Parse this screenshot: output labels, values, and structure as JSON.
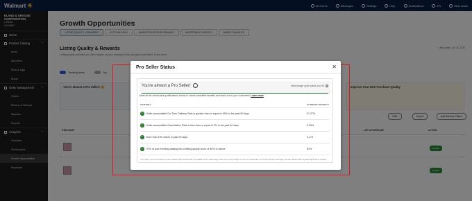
{
  "topbar": {
    "brand": "Walmart",
    "brand_sub": "Seller Center",
    "nav": [
      {
        "label": "All Stores",
        "icon": "store-icon"
      },
      {
        "label": "Messages",
        "icon": "message-icon"
      },
      {
        "label": "Settings",
        "icon": "gear-icon"
      },
      {
        "label": "Help",
        "icon": "help-icon"
      },
      {
        "label": "Notifications",
        "icon": "bell-icon"
      },
      {
        "label": "EN",
        "icon": "globe-icon"
      },
      {
        "label": "Hello Ansel",
        "icon": "user-icon"
      }
    ]
  },
  "sidebar": {
    "org_name": "ELAND & GROUSE CORPORATION",
    "org_line1": "LONDA",
    "org_line2": "10026867",
    "sections": [
      {
        "label": "Home",
        "icon": "home-icon",
        "items": []
      },
      {
        "label": "Product Catalog",
        "icon": "catalog-icon",
        "items": [
          "Items",
          "Add Items",
          "Price & Tags",
          "Brand"
        ]
      },
      {
        "label": "Order Management",
        "icon": "order-icon",
        "items": [
          "Orders",
          "Returns & Refunds",
          "Disputes",
          "Reports"
        ]
      },
      {
        "label": "Analytics",
        "icon": "analytics-icon",
        "items": [
          "Overview",
          "Performance",
          "Growth Opportunities",
          "Payments"
        ]
      }
    ],
    "active_item": "Growth Opportunities"
  },
  "main": {
    "title": "Growth Opportunities",
    "tabs": [
      "LISTING QUALITY & REWARDS",
      "OUTCOME VIEW",
      "MARKETPLACE PERFORMANCE",
      "ASSORTMENT GROWTH",
      "MARKET INSIGHTS"
    ],
    "subtitle": "Listing Quality & Rewards",
    "description": "Listing quality provides you with insights on your catalog to help you grow your sales. Learn more",
    "last_updated": "Last update: Jun 28, 2023",
    "toggles": [
      {
        "label": "Trending Items",
        "on": true
      },
      {
        "label": "Top",
        "on": false
      }
    ],
    "card_left_title": "You're almost a Pro Seller! 😊",
    "card_right_title": "Improve Your Item Purchase Quality",
    "filters": [
      "Filter",
      "Export"
    ],
    "add_button": "Add Attribute Filters",
    "table_cols": [
      "ITEM NAME",
      "LIST & PURCHASE",
      "ACTION"
    ],
    "row_action": "Update"
  },
  "modal": {
    "title": "Pro Seller Status",
    "close_icon": "close-icon",
    "heading": "You're almost a Pro Seller!",
    "heading_icon": "smile-icon",
    "next_update": "Next badge cycle starts Jun 05",
    "progress_color": "#2d7d3a",
    "intro": "Meet all the criteria and qualifications' below to unlock incredible benefits and stand out to your customers.",
    "learn_more": "Learn more",
    "col_criteria": "CRITERIA",
    "col_metrics": "CURRENT METRICS",
    "criteria": [
      {
        "text": "Seller-accountable On-Time Delivery Rate is greater than or equal to 95% in the past 90 days",
        "metric": "97.27%"
      },
      {
        "text": "Seller-accountable Cancellation Rate is less than or equal to 2% in the past 90 days",
        "metric": "0.09%"
      },
      {
        "text": "More than 100 orders in past 90 days",
        "metric": "4,173"
      },
      {
        "text": "70% of your trending catalog has a listing quality score of 80% or above",
        "metric": "81%"
      }
    ],
    "footnote": "* As a seller, you must not have any policy violations that would prohibit your eligibility for Pro Seller badge. Seller may receive a badge if on the next update date, on or before 30 days from badge cycle start. Metrics data may differ slightly due to rounding.",
    "check_color": "#2e7d32",
    "highlight_color": "#e01818"
  }
}
